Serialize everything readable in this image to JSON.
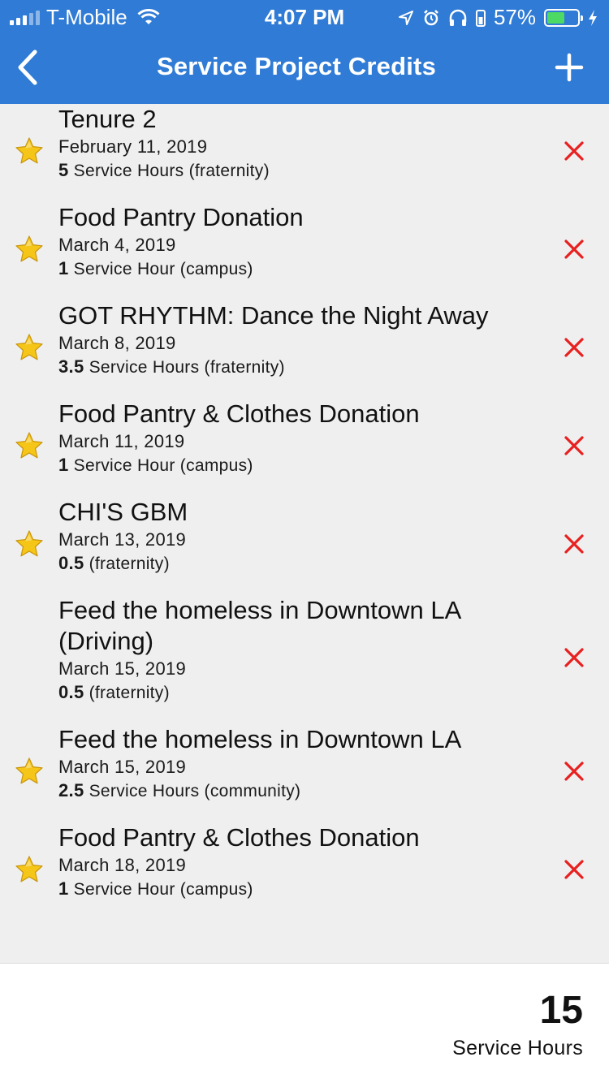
{
  "status_bar": {
    "carrier": "T-Mobile",
    "time": "4:07 PM",
    "battery_percent": "57%",
    "battery_level": 0.57,
    "battery_color": "#4cd964",
    "icons": [
      "signal-icon",
      "wifi-icon",
      "location-icon",
      "alarm-icon",
      "headphones-icon",
      "battery-icon",
      "charging-icon"
    ]
  },
  "nav": {
    "title": "Service Project Credits",
    "back_icon": "chevron-left-icon",
    "add_icon": "plus-icon",
    "bar_color": "#2f7bd5"
  },
  "credits": [
    {
      "title": "Tenure 2",
      "date": "February 11, 2019",
      "amount": "5",
      "unit": "Service Hours",
      "category": "(fraternity)",
      "starred": true
    },
    {
      "title": "Food Pantry Donation",
      "date": "March 4, 2019",
      "amount": "1",
      "unit": "Service Hour",
      "category": "(campus)",
      "starred": true
    },
    {
      "title": "GOT RHYTHM: Dance the Night Away",
      "date": "March 8, 2019",
      "amount": "3.5",
      "unit": "Service Hours",
      "category": "(fraternity)",
      "starred": true
    },
    {
      "title": "Food Pantry & Clothes Donation",
      "date": "March 11, 2019",
      "amount": "1",
      "unit": "Service Hour",
      "category": "(campus)",
      "starred": true
    },
    {
      "title": "CHI'S GBM",
      "date": "March 13, 2019",
      "amount": "0.5",
      "unit": "",
      "category": "(fraternity)",
      "starred": true
    },
    {
      "title": "Feed the homeless in Downtown LA (Driving)",
      "date": "March 15, 2019",
      "amount": "0.5",
      "unit": "",
      "category": "(fraternity)",
      "starred": false
    },
    {
      "title": "Feed the homeless in Downtown LA",
      "date": "March 15, 2019",
      "amount": "2.5",
      "unit": "Service Hours",
      "category": "(community)",
      "starred": true
    },
    {
      "title": "Food Pantry & Clothes Donation",
      "date": "March 18, 2019",
      "amount": "1",
      "unit": "Service Hour",
      "category": "(campus)",
      "starred": true
    }
  ],
  "footer": {
    "total": "15",
    "total_label": "Service Hours"
  },
  "colors": {
    "delete": "#e8201f",
    "star": "#f5c518"
  }
}
